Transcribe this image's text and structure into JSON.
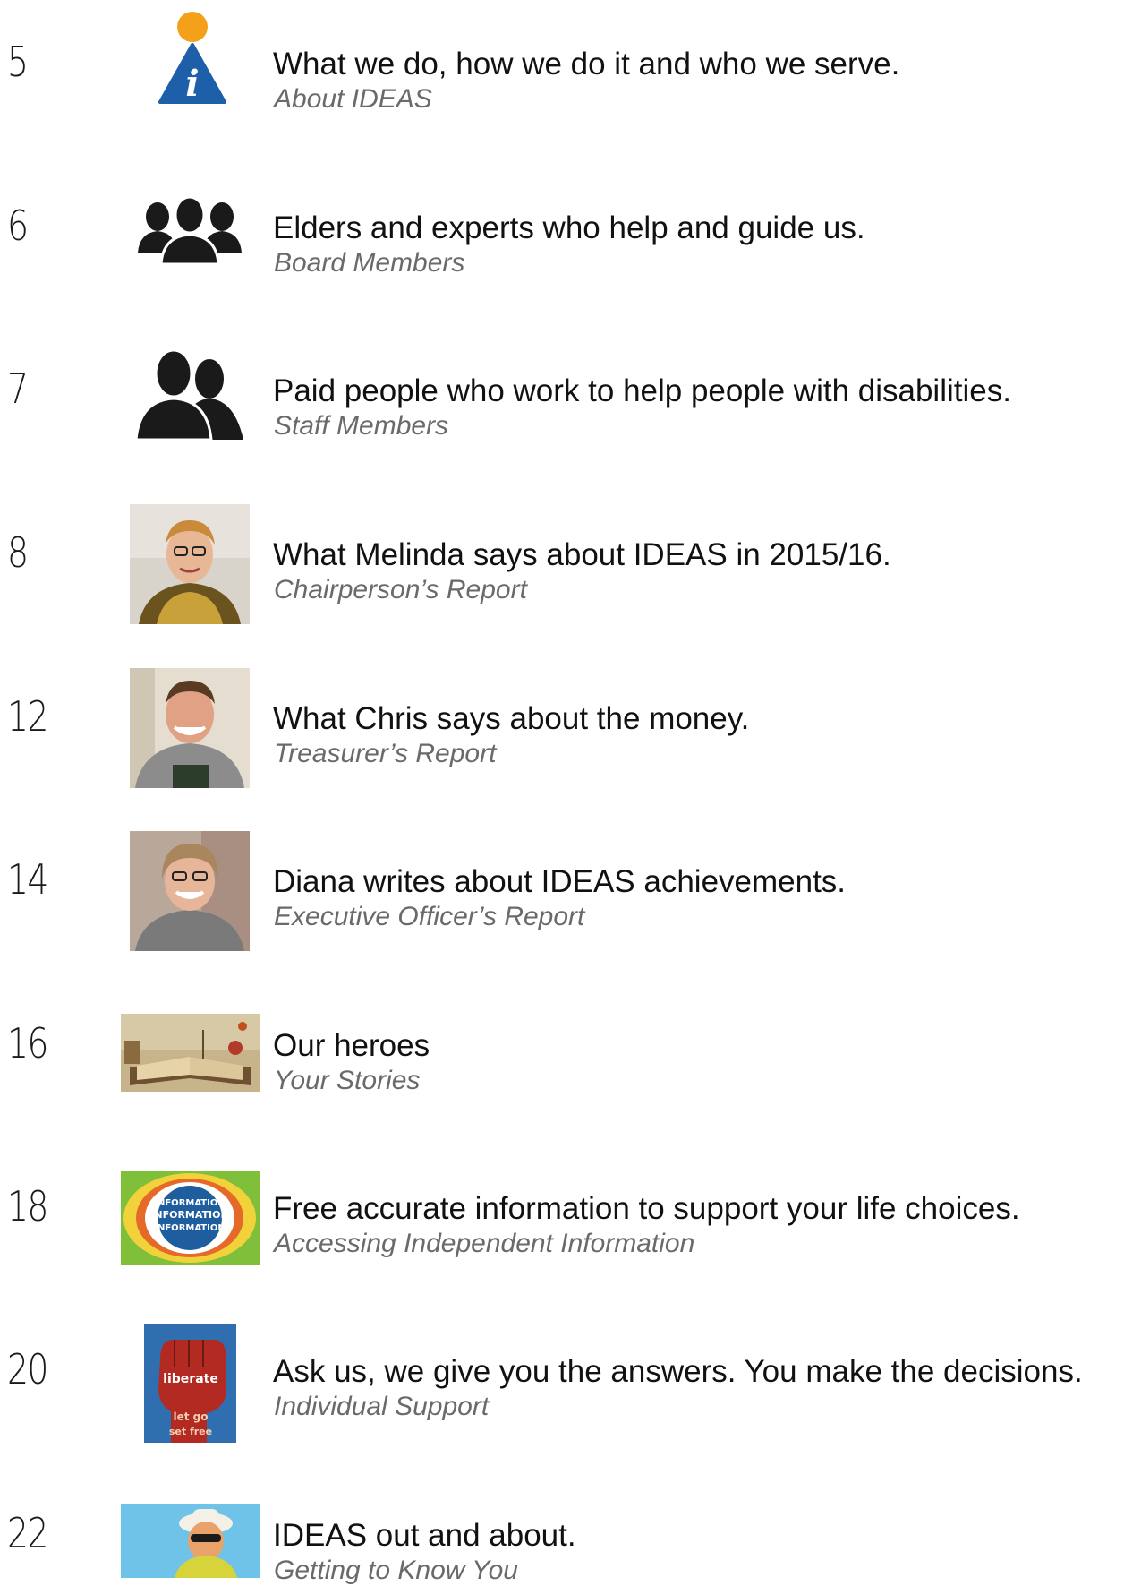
{
  "entries": [
    {
      "page": "5",
      "title": "What we do, how we do it and who we serve.",
      "subtitle": "About IDEAS",
      "icon": "info-icon"
    },
    {
      "page": "6",
      "title": "Elders and experts who help and guide us.",
      "subtitle": "Board Members",
      "icon": "group-three-people-icon"
    },
    {
      "page": "7",
      "title": "Paid people who work to help people with disabilities.",
      "subtitle": "Staff Members",
      "icon": "group-two-people-icon"
    },
    {
      "page": "8",
      "title": "What Melinda says about IDEAS in 2015/16.",
      "subtitle": "Chairperson’s Report",
      "icon": "portrait-photo"
    },
    {
      "page": "12",
      "title": "What Chris says about the money.",
      "subtitle": "Treasurer’s Report",
      "icon": "portrait-photo"
    },
    {
      "page": "14",
      "title": "Diana writes about IDEAS achievements.",
      "subtitle": "Executive Officer’s Report",
      "icon": "portrait-photo"
    },
    {
      "page": "16",
      "title": "Our heroes",
      "subtitle": "Your Stories",
      "icon": "storybook-photo"
    },
    {
      "page": "18",
      "title": "Free accurate information to support your life choices.",
      "subtitle": "Accessing Independent Information",
      "icon": "information-globe-photo"
    },
    {
      "page": "20",
      "title": "Ask us, we give you the answers. You make the decisions.",
      "subtitle": "Individual Support",
      "icon": "fist-word-art-photo"
    },
    {
      "page": "22",
      "title": "IDEAS out and about.",
      "subtitle": "Getting to Know You",
      "icon": "person-in-hat-photo"
    }
  ],
  "colors": {
    "text": "#111111",
    "subtitle": "#6a6a6a",
    "info_blue": "#1d5fa8",
    "info_orange": "#f5a01a",
    "silhouette": "#1a1a1a"
  }
}
